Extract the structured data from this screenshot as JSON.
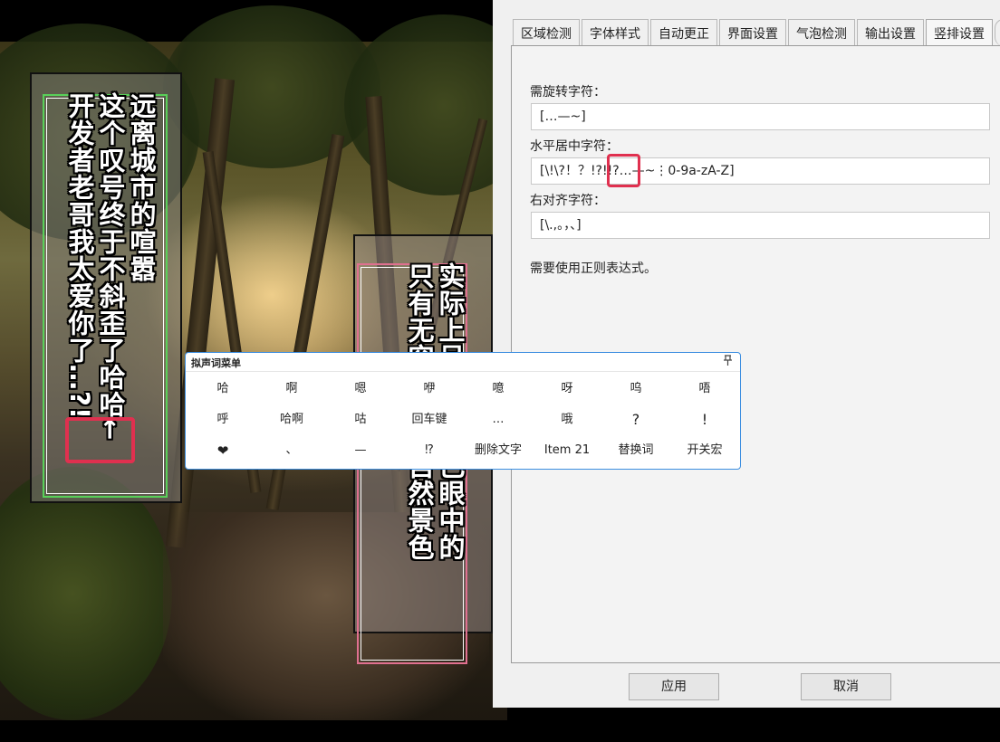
{
  "comic": {
    "left_col1": "远离城市的喧嚣",
    "left_col2": "这个叹号终于不斜歪了哈哈←",
    "left_col3": "开发者老哥我太爱你了…?!",
    "right_col1": "实际上呈现在自己眼中的",
    "right_col2": "只有无穷无尽的自然景色"
  },
  "settings": {
    "tabs": [
      "区域检测",
      "字体样式",
      "自动更正",
      "界面设置",
      "气泡检测",
      "输出设置",
      "竖排设置"
    ],
    "active_tab": "竖排设置",
    "rotate_label": "需旋转字符：",
    "rotate_value": "[…—~]",
    "hcenter_label": "水平居中字符：",
    "hcenter_value": "[\\!\\?！？!?!!?…—~⋮0-9a-zA-Z]",
    "hcenter_value_display": "[\\!\\?！？!?!!?…—~⋮0-9a-zA-Z]",
    "right_align_label": "右对齐字符：",
    "right_align_value": "[\\.,。，、]",
    "hint": "需要使用正则表达式。",
    "apply_button": "应用",
    "cancel_button": "取消"
  },
  "onomatopoeia_menu": {
    "title": "拟声词菜单",
    "pin_icon": "pin-icon",
    "items": [
      [
        "哈",
        "啊",
        "嗯",
        "咿",
        "噫",
        "呀",
        "呜",
        "唔"
      ],
      [
        "呼",
        "哈啊",
        "咕",
        "回车键",
        "…",
        "哦",
        "?",
        "!"
      ],
      [
        "❤",
        "、",
        "—",
        "⁉",
        "删除文字",
        "Item 21",
        "替换词",
        "开关宏"
      ]
    ]
  },
  "colors": {
    "highlight": "#e0304f",
    "green_box": "#59d059",
    "pink_box": "#e07090",
    "popup_border": "#3c8ee0"
  }
}
